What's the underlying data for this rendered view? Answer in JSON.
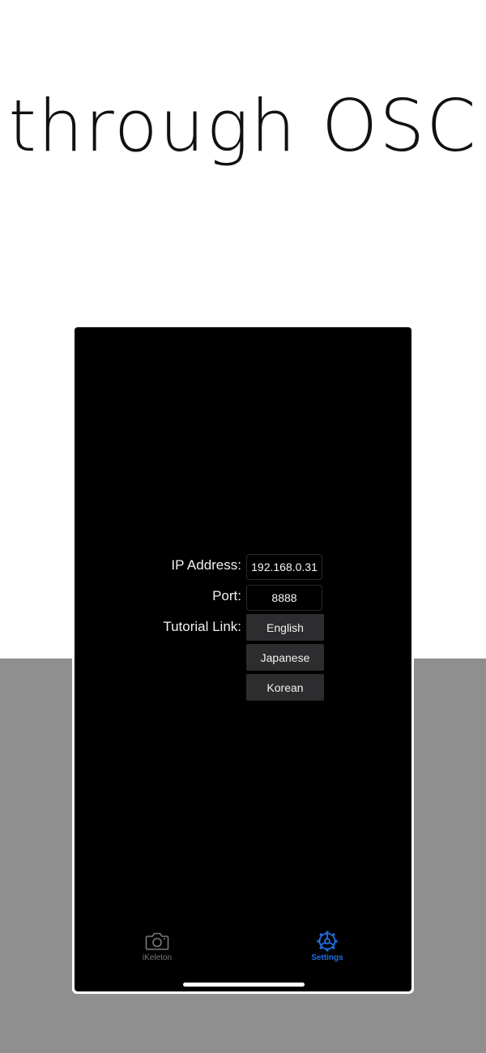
{
  "headline": "through OSC",
  "settings": {
    "ip_label": "IP Address:",
    "ip_value": "192.168.0.31",
    "port_label": "Port:",
    "port_value": "8888",
    "tutorial_label": "Tutorial Link:",
    "links": [
      "English",
      "Japanese",
      "Korean"
    ]
  },
  "tabbar": {
    "tabs": [
      {
        "label": "iKeleton",
        "icon": "camera-icon",
        "active": false
      },
      {
        "label": "Settings",
        "icon": "gear-icon",
        "active": true
      }
    ]
  },
  "colors": {
    "accent": "#1e6fe0",
    "band": "#8f8f8f",
    "screen": "#000000",
    "button": "#2d2d2f"
  }
}
